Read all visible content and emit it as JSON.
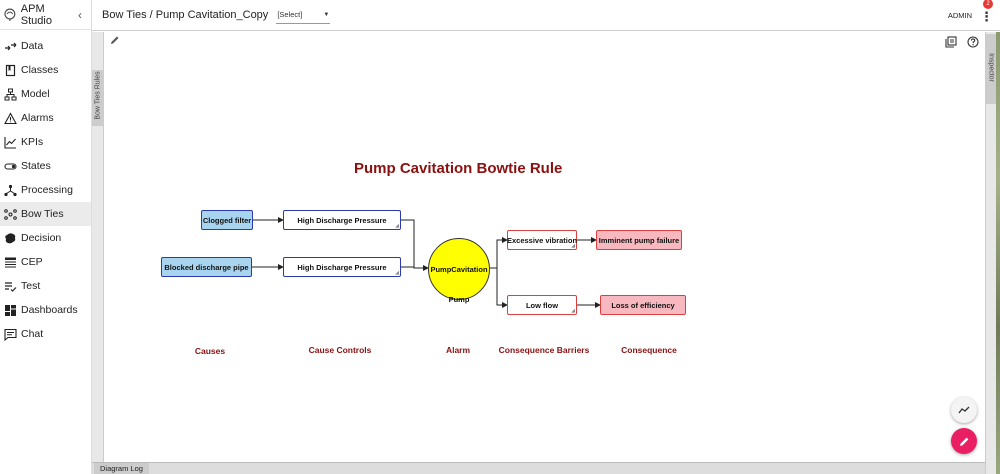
{
  "app": {
    "title": "APM Studio",
    "collapse_glyph": "‹"
  },
  "sidebar": {
    "items": [
      {
        "label": "Data",
        "icon": "data-flow-icon"
      },
      {
        "label": "Classes",
        "icon": "book-icon"
      },
      {
        "label": "Model",
        "icon": "hierarchy-icon"
      },
      {
        "label": "Alarms",
        "icon": "warning-icon"
      },
      {
        "label": "KPIs",
        "icon": "trend-chart-icon"
      },
      {
        "label": "States",
        "icon": "toggle-icon"
      },
      {
        "label": "Processing",
        "icon": "network-icon"
      },
      {
        "label": "Bow Ties",
        "icon": "bowtie-icon",
        "active": true
      },
      {
        "label": "Decision",
        "icon": "brain-icon"
      },
      {
        "label": "CEP",
        "icon": "table-icon"
      },
      {
        "label": "Test",
        "icon": "checklist-icon"
      },
      {
        "label": "Dashboards",
        "icon": "dashboard-icon"
      },
      {
        "label": "Chat",
        "icon": "chat-icon"
      }
    ]
  },
  "header": {
    "breadcrumb": "Bow Ties / Pump Cavitation_Copy",
    "select_value": "[Select]",
    "user": "ADMIN",
    "notification_count": "2"
  },
  "panels": {
    "left_tab": "Bow Ties Rules",
    "right_tab": "Inspector",
    "log_tab": "Diagram Log"
  },
  "diagram": {
    "title": "Pump Cavitation Bowtie Rule",
    "causes": [
      "Clogged filter",
      "Blocked discharge pipe"
    ],
    "controls": [
      "High Discharge Pressure",
      "High Discharge Pressure"
    ],
    "alarm": {
      "name": "PumpCavitation",
      "label": "Pump"
    },
    "barriers": [
      "Excessive vibration",
      "Low flow"
    ],
    "consequences": [
      "Imminent pump failure",
      "Loss of efficiency"
    ],
    "columns": {
      "causes": "Causes",
      "controls": "Cause Controls",
      "alarm": "Alarm",
      "barriers": "Consequence Barriers",
      "consequence": "Consequence"
    },
    "colors": {
      "title": "#8b1010",
      "cause_fill": "#a9d4ef",
      "cause_border": "#2b39b0",
      "alarm_fill": "#ffff00",
      "consequence_fill": "#f7b8bf",
      "consequence_border": "#d94141"
    }
  }
}
